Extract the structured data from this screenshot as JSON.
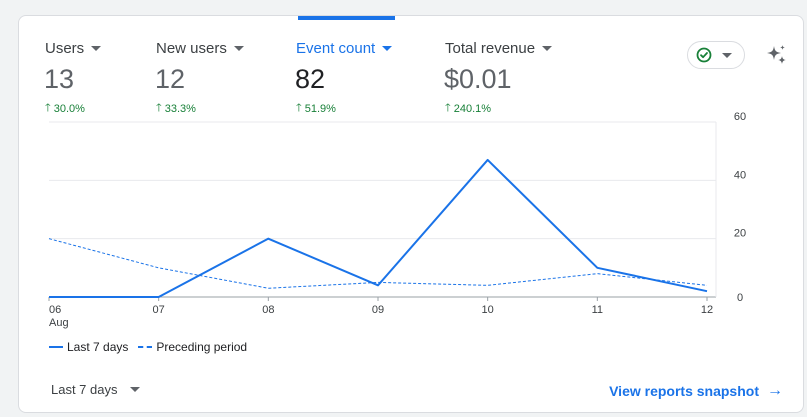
{
  "metrics": [
    {
      "label": "Users",
      "value": "13",
      "change": "30.0%",
      "active": false
    },
    {
      "label": "New users",
      "value": "12",
      "change": "33.3%",
      "active": false
    },
    {
      "label": "Event count",
      "value": "82",
      "change": "51.9%",
      "active": true
    },
    {
      "label": "Total revenue",
      "value": "$0.01",
      "change": "240.1%",
      "active": false
    }
  ],
  "colors": {
    "accent": "#1a73e8",
    "positive": "#188038",
    "status_ok": "#188038"
  },
  "icons": {
    "status": "check-circle-icon",
    "insights": "sparkle-icon",
    "trend": "arrow-up-icon",
    "link": "arrow-right-icon"
  },
  "legend": {
    "current": "Last 7 days",
    "previous": "Preceding period"
  },
  "date_range": "Last 7 days",
  "snapshot_link": "View reports snapshot",
  "chart_data": {
    "type": "line",
    "x": [
      "06",
      "07",
      "08",
      "09",
      "10",
      "11",
      "12"
    ],
    "x_sublabel": "Aug",
    "yticks": [
      0,
      20,
      40,
      60
    ],
    "ylim": [
      0,
      60
    ],
    "y_axis_position": "right",
    "grid": true,
    "legend_placement": "bottom-left",
    "series": [
      {
        "name": "Last 7 days",
        "style": "solid",
        "values": [
          0,
          0,
          20,
          4,
          47,
          10,
          2
        ]
      },
      {
        "name": "Preceding period",
        "style": "dashed",
        "values": [
          20,
          10,
          3,
          5,
          4,
          8,
          4
        ]
      }
    ]
  }
}
